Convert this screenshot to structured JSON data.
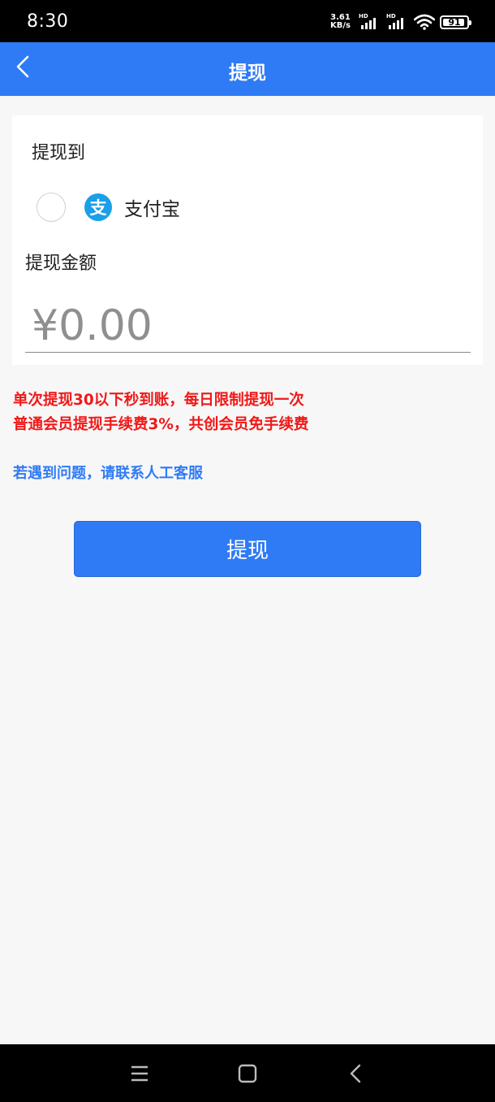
{
  "status_bar": {
    "time": "8:30",
    "net_speed_value": "3.61",
    "net_speed_unit": "KB/s",
    "signal_1_label": "HD",
    "signal_2_label": "HD",
    "battery": "91"
  },
  "header": {
    "title": "提现",
    "back_icon": "chevron-left-icon"
  },
  "withdraw_form": {
    "to_label": "提现到",
    "method": {
      "label": "支付宝",
      "icon_glyph": "支",
      "selected": false
    },
    "amount_label": "提现金额",
    "amount_placeholder": "¥0.00",
    "amount_value": ""
  },
  "notices": {
    "line1": "单次提现30以下秒到账，每日限制提现一次",
    "line2": "普通会员提现手续费3%，共创会员免手续费"
  },
  "contact_link": "若遇到问题，请联系人工客服",
  "submit_label": "提现",
  "colors": {
    "primary": "#2f7bf5",
    "warning": "#f01818",
    "alipay": "#1a9fe8",
    "background": "#f7f7f7"
  },
  "nav_bar": {
    "menu_icon": "menu-icon",
    "home_icon": "home-square-icon",
    "back_icon": "back-triangle-icon"
  }
}
